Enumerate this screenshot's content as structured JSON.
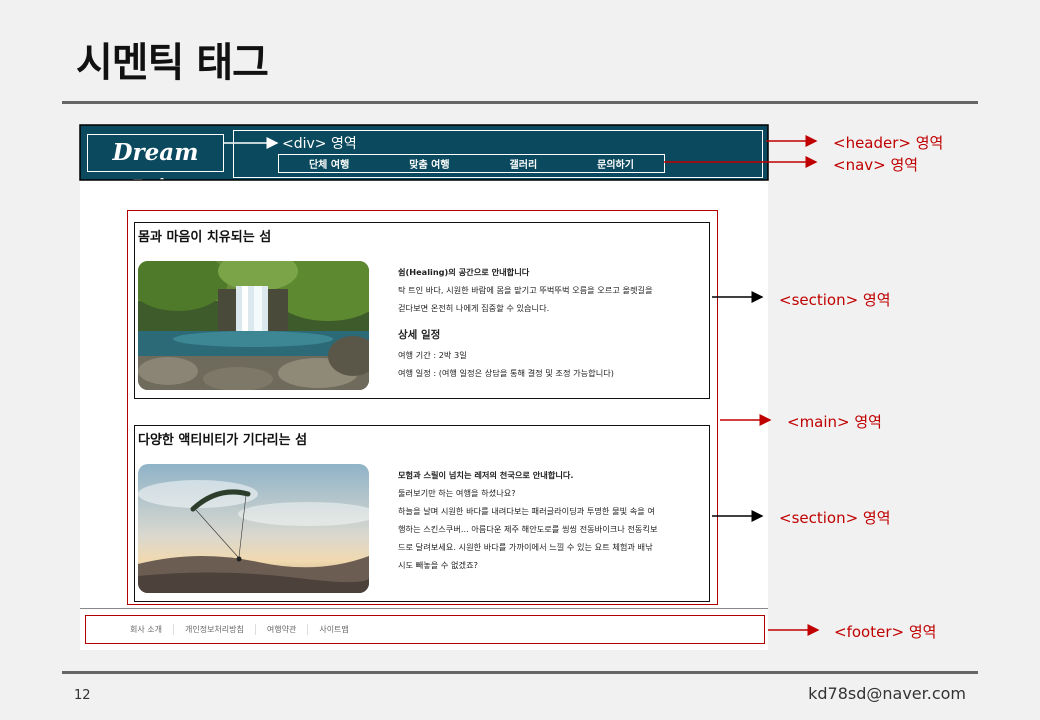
{
  "slide": {
    "title": "시멘틱 태그",
    "page_number": "12",
    "author_email": "kd78sd@naver.com"
  },
  "site": {
    "logo": "Dream Jeju",
    "nav": [
      "단체 여행",
      "맞춤 여행",
      "갤러리",
      "문의하기"
    ],
    "sections": [
      {
        "heading": "몸과 마음이 치유되는 섬",
        "intro": "쉼(Healing)의 공간으로 안내합니다",
        "lines": [
          "탁 트인 바다, 시원한 바람에 몸을 맡기고 뚜벅뚜벅 오름을 오르고 올렛길을",
          "걷다보면 온전히 나에게 집중할 수 있습니다."
        ],
        "subheading": "상세 일정",
        "details": [
          "여행 기간 : 2박 3일",
          "여행 일정 : (여행 일정은 상담을 통해 결정 및 조정 가능합니다)"
        ]
      },
      {
        "heading": "다양한 액티비티가 기다리는 섬",
        "intro": "모험과 스릴이 넘치는 레저의 천국으로 안내합니다.",
        "lines": [
          "둘러보기만 하는 여행을 하셨나요?",
          "하늘을 날며 시원한 바다를 내려다보는 패러글라이딩과 투명한 물빛 속을 여",
          "행하는 스킨스쿠버... 아름다운 제주 해안도로를 씽씽 전동바이크나 전동킥보",
          "드로 달려보세요. 시원한 바다를 가까이에서 느낄 수 있는 요트 체험과 배낚",
          "시도 빼놓을 수 없겠죠?"
        ]
      }
    ],
    "footer_links": [
      "회사 소개",
      "개인정보처리방침",
      "여행약관",
      "사이트맵"
    ]
  },
  "annotations": {
    "div": "<div> 영역",
    "header": "<header> 영역",
    "nav": "<nav> 영역",
    "section1": "<section> 영역",
    "main": "<main> 영역",
    "section2": "<section> 영역",
    "footer": "<footer> 영역"
  },
  "colors": {
    "header_bg": "#0b4a5e",
    "annotation": "#c00000"
  }
}
